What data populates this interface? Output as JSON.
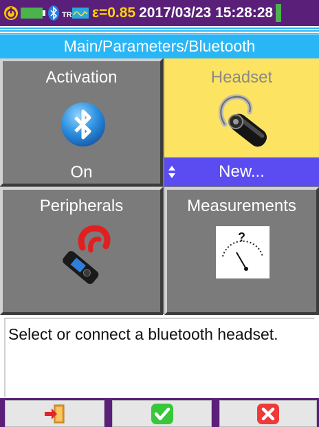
{
  "status_bar": {
    "epsilon": "ε=0.85",
    "datetime": "2017/03/23 15:28:28",
    "icons": [
      "power-icon",
      "battery-icon",
      "bluetooth-status-icon",
      "tr-recording-icon"
    ],
    "colors": {
      "background": "#5a1f78",
      "epsilon_text": "#ffd400",
      "battery_fill": "#4cb34c"
    }
  },
  "title": "Main/Parameters/Bluetooth",
  "tiles": [
    {
      "label": "Activation",
      "value": "On",
      "icon": "bluetooth-icon"
    },
    {
      "label": "Headset",
      "value": "New...",
      "icon": "headset-icon",
      "selected": true
    },
    {
      "label": "Peripherals",
      "icon": "clamp-meter-icon"
    },
    {
      "label": "Measurements",
      "icon": "analog-meter-icon",
      "icon_symbol": "?"
    }
  ],
  "help_text": "Select or connect a bluetooth headset.",
  "toolbar": {
    "buttons": [
      {
        "icon": "exit-icon"
      },
      {
        "icon": "confirm-check-icon"
      },
      {
        "icon": "cancel-x-icon"
      }
    ]
  },
  "colors": {
    "title_bar": "#29b6f6",
    "tile_background": "#7b7b7b",
    "tile_selected": "#fde362",
    "value_bar": "#5b4cf2",
    "confirm": "#37c73a",
    "cancel": "#ee3a3a"
  }
}
